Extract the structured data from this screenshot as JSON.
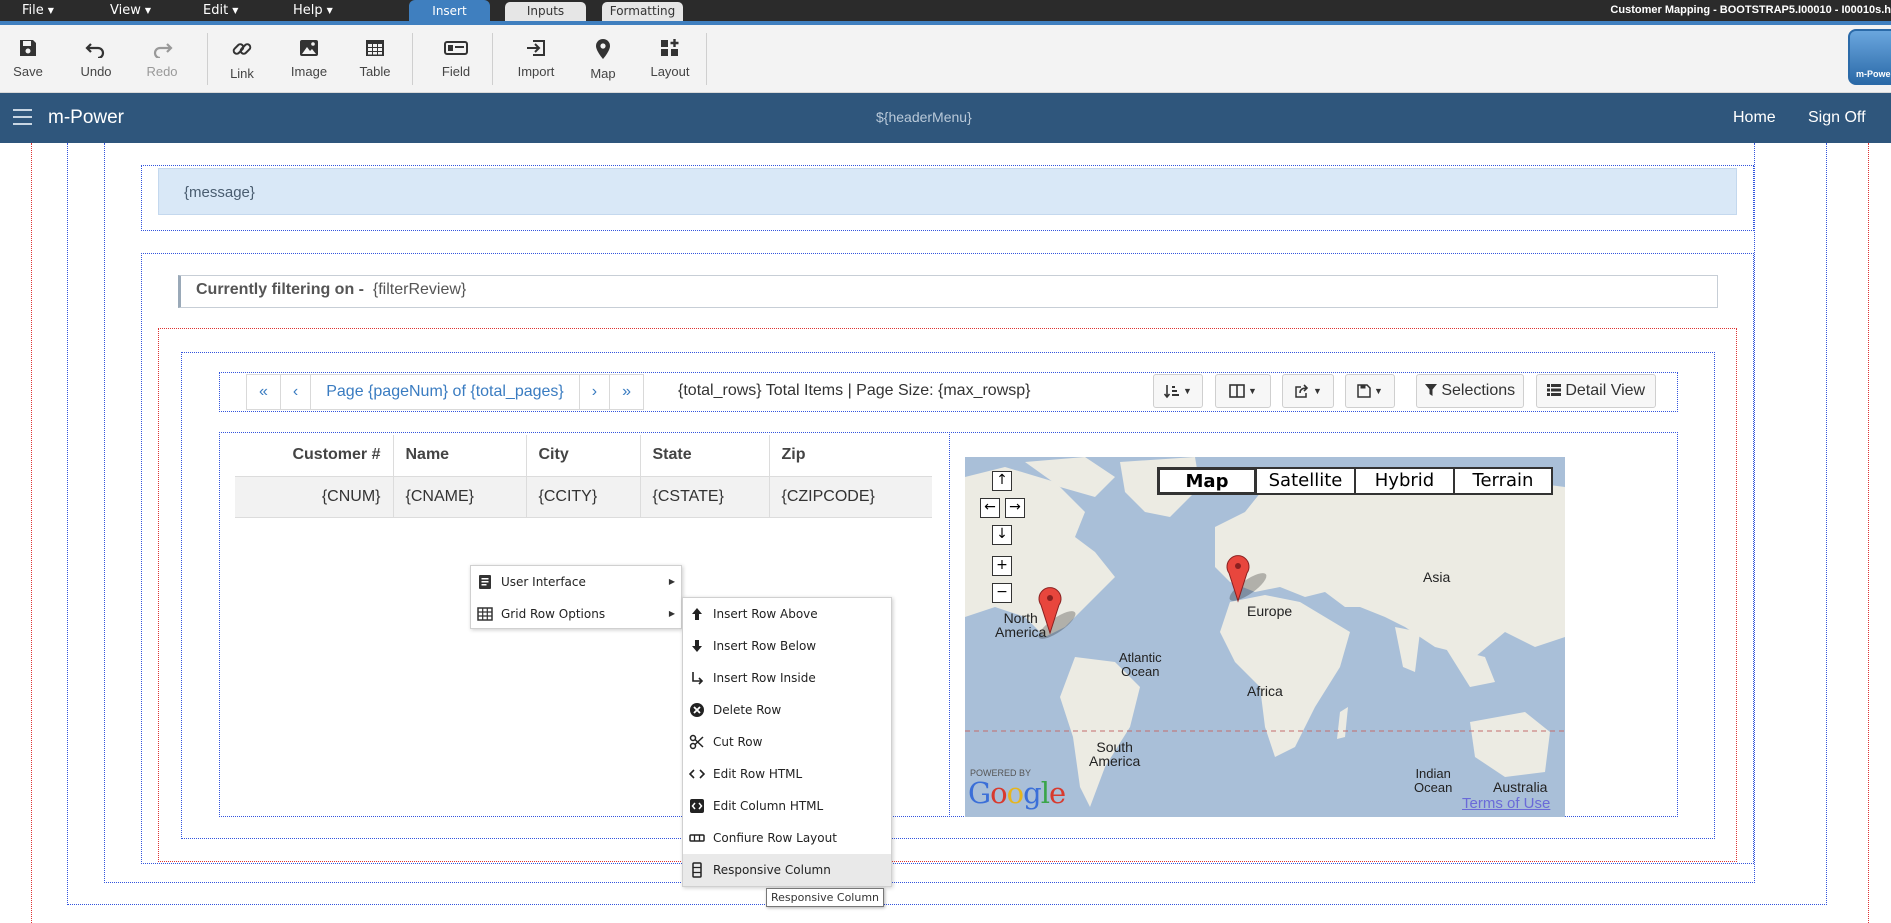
{
  "menubar": {
    "menus": [
      "File",
      "View",
      "Edit",
      "Help"
    ],
    "tabs": [
      "Insert",
      "Inputs",
      "Formatting"
    ],
    "window_title": "Customer Mapping - BOOTSTRAP5.I00010 - I00010s.h"
  },
  "toolbar": {
    "save": "Save",
    "undo": "Undo",
    "redo": "Redo",
    "link": "Link",
    "image": "Image",
    "table": "Table",
    "field": "Field",
    "import": "Import",
    "map": "Map",
    "layout": "Layout",
    "logo_text": "m-Power"
  },
  "navbar": {
    "brand": "m-Power",
    "header_menu": "${headerMenu}",
    "home": "Home",
    "sign_off": "Sign Off"
  },
  "message": "{message}",
  "filter": {
    "label": "Currently filtering on -",
    "value": "{filterReview}"
  },
  "pager": {
    "first": "«",
    "prev": "‹",
    "page_label": "Page  {pageNum}  of  {total_pages}",
    "next": "›",
    "last": "»",
    "total_text": "{total_rows}  Total Items | Page Size:  {max_rowsp}"
  },
  "buttons": {
    "selections": "Selections",
    "detail_view": "Detail View"
  },
  "grid": {
    "headers": [
      "Customer #",
      "Name",
      "City",
      "State",
      "Zip"
    ],
    "row": [
      "{CNUM}",
      "{CNAME}",
      "{CCITY}",
      "{CSTATE}",
      "{CZIPCODE}"
    ]
  },
  "map": {
    "types": [
      "Map",
      "Satellite",
      "Hybrid",
      "Terrain"
    ],
    "selected_type": "Map",
    "labels": {
      "north_america": "North\nAmerica",
      "atlantic": "Atlantic\nOcean",
      "europe": "Europe",
      "asia": "Asia",
      "africa": "Africa",
      "south_america": "South\nAmerica",
      "indian_ocean": "Indian\nOcean",
      "australia": "Australia"
    },
    "powered_by": "POWERED BY",
    "google": "Google",
    "terms": "Terms of Use"
  },
  "context_menu": {
    "items": [
      "User Interface",
      "Grid Row Options"
    ]
  },
  "submenu": {
    "items": [
      "Insert Row Above",
      "Insert Row Below",
      "Insert Row Inside",
      "Delete Row",
      "Cut Row",
      "Edit Row HTML",
      "Edit Column HTML",
      "Confiure Row Layout",
      "Responsive Column"
    ],
    "highlighted": "Responsive Column"
  },
  "tooltip": "Responsive Column"
}
